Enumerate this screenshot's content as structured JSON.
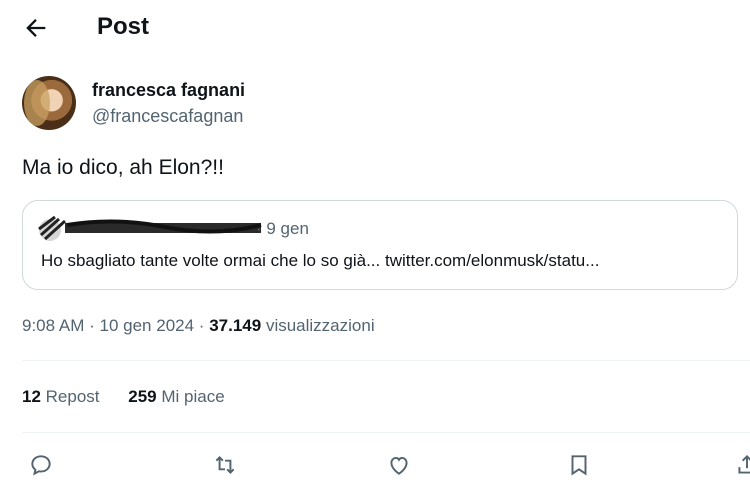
{
  "header": {
    "title": "Post"
  },
  "author": {
    "display_name": "francesca fagnani",
    "handle": "@francescafagnan"
  },
  "post": {
    "text": "Ma io dico, ah Elon?!!",
    "time": "9:08 AM",
    "date": "10 gen 2024",
    "views_count": "37.149",
    "views_label": "visualizzazioni"
  },
  "quote": {
    "date": "· 9 gen",
    "text": "Ho sbagliato tante volte ormai che lo so già... twitter.com/elonmusk/statu..."
  },
  "stats": {
    "reposts_count": "12",
    "reposts_label": "Repost",
    "likes_count": "259",
    "likes_label": "Mi piace"
  },
  "icons": {
    "back": "arrow-left-icon",
    "reply": "reply-icon",
    "repost": "repost-icon",
    "like": "heart-icon",
    "bookmark": "bookmark-icon"
  },
  "colors": {
    "text": "#0f1419",
    "secondary": "#536471",
    "border": "#cfd9de"
  }
}
